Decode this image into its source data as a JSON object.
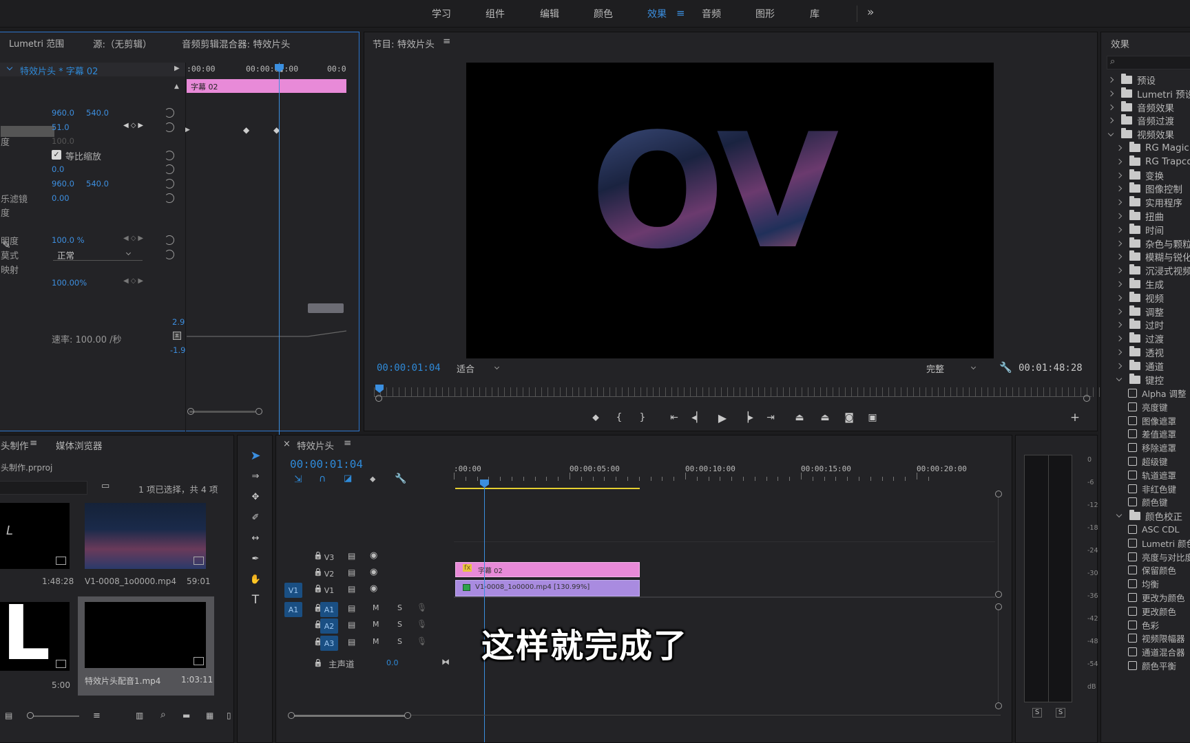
{
  "workspaces": [
    "学习",
    "组件",
    "编辑",
    "颜色",
    "效果",
    "音频",
    "图形",
    "库"
  ],
  "workspace_more": "»",
  "effect_controls": {
    "tabs": [
      "Lumetri 范围",
      "源:（无剪辑）",
      "音频剪辑混合器: 特效片头"
    ],
    "clip_path": "特效片头 * 字幕 02",
    "timeline_ticks": [
      ":00:00",
      "00:00:0▮:00",
      "00:0"
    ],
    "clip_label": "字幕 02",
    "rows": [
      {
        "label": "",
        "v1": "960.0",
        "v2": "540.0"
      },
      {
        "label": "",
        "v1": "51.0",
        "v2": ""
      },
      {
        "label": "度",
        "v1": "100.0",
        "v2": ""
      },
      {
        "label": "",
        "v1": "",
        "v2": "",
        "checkbox": "等比缩放"
      },
      {
        "label": "",
        "v1": "0.0",
        "v2": ""
      },
      {
        "label": "",
        "v1": "960.0",
        "v2": "540.0"
      },
      {
        "label": "乐滤镜",
        "v1": "0.00",
        "v2": ""
      },
      {
        "label": "度",
        "v1": "",
        "v2": ""
      },
      {
        "label": "",
        "v1": "",
        "v2": ""
      },
      {
        "label": "明度",
        "v1": "100.0 %",
        "v2": ""
      },
      {
        "label": "莫式",
        "v1": "",
        "v2": "",
        "select": "正常"
      },
      {
        "label": "映射",
        "v1": "",
        "v2": ""
      },
      {
        "label": "",
        "v1": "100.00%",
        "v2": ""
      }
    ],
    "speed_label": "速率: 100.00 /秒",
    "graph_top": "2.9",
    "graph_bottom": "-1.9"
  },
  "program": {
    "title": "节目: 特效片头",
    "menu_icon": "≡",
    "timecode": "00:00:01:04",
    "fit": "适合",
    "quality": "完整",
    "duration": "00:01:48:28",
    "preview_text": "OV"
  },
  "project": {
    "tabs": [
      "头制作",
      "媒体浏览器"
    ],
    "file": "头制作.prproj",
    "selection_info": "1 项已选择，共 4 项",
    "items": [
      {
        "name": "",
        "duration": "1:48:28"
      },
      {
        "name": "V1-0008_1o0000.mp4",
        "duration": "59:01"
      },
      {
        "name": "",
        "duration": "5:00"
      },
      {
        "name": "特效片头配音1.mp4",
        "duration": "1:03:11"
      }
    ]
  },
  "timeline": {
    "title": "特效片头",
    "close": "×",
    "timecode": "00:00:01:04",
    "ruler": [
      ":00:00",
      "00:00:05:00",
      "00:00:10:00",
      "00:00:15:00",
      "00:00:20:00"
    ],
    "tracks_video": [
      "V3",
      "V2",
      "V1"
    ],
    "tracks_audio": [
      "A1",
      "A2",
      "A3"
    ],
    "source_v": "V1",
    "source_a": "A1",
    "mute": "M",
    "solo": "S",
    "master": "主声道",
    "master_val": "0.0",
    "clip_title": "字幕 02",
    "clip_video": "V1-0008_1o0000.mp4 [130.99%]"
  },
  "subtitle": "这样就完成了",
  "meter": {
    "labels": [
      "0",
      "-6",
      "-12",
      "-18",
      "-24",
      "-30",
      "-36",
      "-42",
      "-48",
      "-54",
      "dB"
    ],
    "solo": [
      "S",
      "S"
    ]
  },
  "effects": {
    "title": "效果",
    "search_placeholder": "",
    "items": [
      {
        "t": "预设",
        "type": "folder",
        "lvl": 0
      },
      {
        "t": "Lumetri 预设",
        "type": "folder",
        "lvl": 0
      },
      {
        "t": "音频效果",
        "type": "folder",
        "lvl": 0
      },
      {
        "t": "音频过渡",
        "type": "folder",
        "lvl": 0
      },
      {
        "t": "视频效果",
        "type": "folder",
        "lvl": 0,
        "open": true
      },
      {
        "t": "RG Magic B",
        "type": "folder",
        "lvl": 1
      },
      {
        "t": "RG Trapcod",
        "type": "folder",
        "lvl": 1
      },
      {
        "t": "变换",
        "type": "folder",
        "lvl": 1
      },
      {
        "t": "图像控制",
        "type": "folder",
        "lvl": 1
      },
      {
        "t": "实用程序",
        "type": "folder",
        "lvl": 1
      },
      {
        "t": "扭曲",
        "type": "folder",
        "lvl": 1
      },
      {
        "t": "时间",
        "type": "folder",
        "lvl": 1
      },
      {
        "t": "杂色与颗粒",
        "type": "folder",
        "lvl": 1
      },
      {
        "t": "模糊与锐化",
        "type": "folder",
        "lvl": 1
      },
      {
        "t": "沉浸式视频",
        "type": "folder",
        "lvl": 1
      },
      {
        "t": "生成",
        "type": "folder",
        "lvl": 1
      },
      {
        "t": "视频",
        "type": "folder",
        "lvl": 1
      },
      {
        "t": "调整",
        "type": "folder",
        "lvl": 1
      },
      {
        "t": "过时",
        "type": "folder",
        "lvl": 1
      },
      {
        "t": "过渡",
        "type": "folder",
        "lvl": 1
      },
      {
        "t": "透视",
        "type": "folder",
        "lvl": 1
      },
      {
        "t": "通道",
        "type": "folder",
        "lvl": 1
      },
      {
        "t": "键控",
        "type": "folder",
        "lvl": 1,
        "open": true
      },
      {
        "t": "Alpha 调整",
        "type": "preset",
        "lvl": 2
      },
      {
        "t": "亮度键",
        "type": "preset",
        "lvl": 2
      },
      {
        "t": "图像遮罩",
        "type": "preset",
        "lvl": 2
      },
      {
        "t": "差值遮罩",
        "type": "preset",
        "lvl": 2
      },
      {
        "t": "移除遮罩",
        "type": "preset",
        "lvl": 2
      },
      {
        "t": "超级键",
        "type": "preset",
        "lvl": 2
      },
      {
        "t": "轨道遮罩",
        "type": "preset",
        "lvl": 2
      },
      {
        "t": "非红色键",
        "type": "preset",
        "lvl": 2
      },
      {
        "t": "颜色键",
        "type": "preset",
        "lvl": 2
      },
      {
        "t": "颜色校正",
        "type": "folder",
        "lvl": 1,
        "open": true
      },
      {
        "t": "ASC CDL",
        "type": "preset",
        "lvl": 2
      },
      {
        "t": "Lumetri 颜色",
        "type": "preset",
        "lvl": 2
      },
      {
        "t": "亮度与对比度",
        "type": "preset",
        "lvl": 2
      },
      {
        "t": "保留颜色",
        "type": "preset",
        "lvl": 2
      },
      {
        "t": "均衡",
        "type": "preset",
        "lvl": 2
      },
      {
        "t": "更改为颜色",
        "type": "preset",
        "lvl": 2
      },
      {
        "t": "更改颜色",
        "type": "preset",
        "lvl": 2
      },
      {
        "t": "色彩",
        "type": "preset",
        "lvl": 2
      },
      {
        "t": "视频限幅器",
        "type": "preset",
        "lvl": 2
      },
      {
        "t": "通道混合器",
        "type": "preset",
        "lvl": 2
      },
      {
        "t": "颜色平衡",
        "type": "preset",
        "lvl": 2
      }
    ]
  },
  "colors": {
    "accent": "#2f8ad8",
    "clip_pink": "#e88ad8",
    "clip_violet": "#a98be0",
    "playhead": "#3b8fe0"
  }
}
